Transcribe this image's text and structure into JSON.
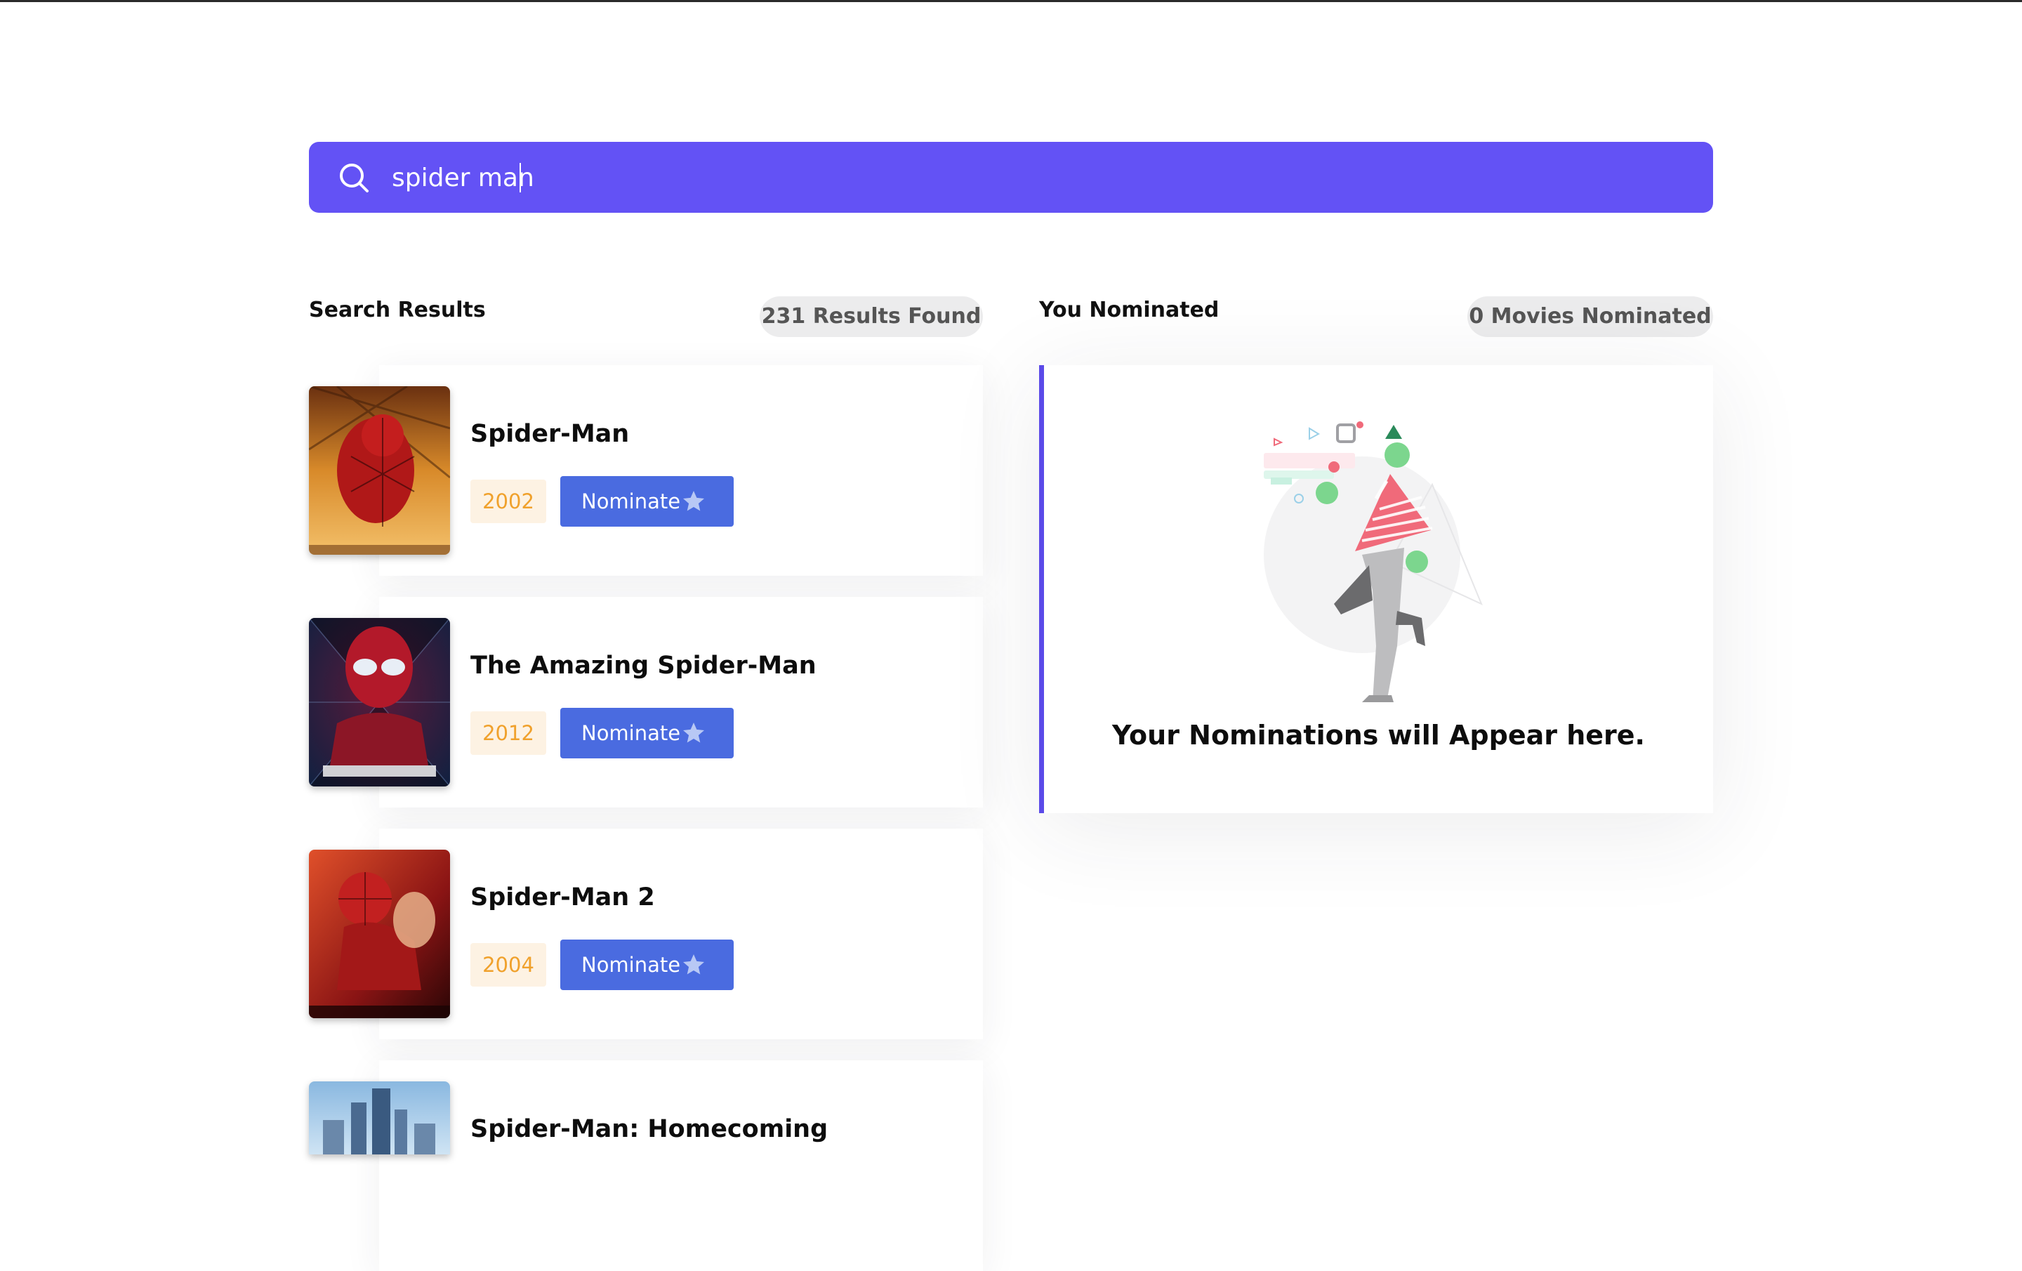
{
  "search": {
    "value": "spider man",
    "icon": "search-icon"
  },
  "results": {
    "title": "Search Results",
    "count_label": "231 Results Found",
    "nominate_label": "Nominate",
    "nominate_icon": "star-icon",
    "items": [
      {
        "title": "Spider-Man",
        "year": "2002"
      },
      {
        "title": "The Amazing Spider-Man",
        "year": "2012"
      },
      {
        "title": "Spider-Man 2",
        "year": "2004"
      },
      {
        "title": "Spider-Man: Homecoming",
        "year": ""
      }
    ]
  },
  "nominations": {
    "title": "You Nominated",
    "count_label": "0 Movies Nominated",
    "empty_text": "Your Nominations will Appear here.",
    "illustration": "empty-nominations-illustration"
  },
  "colors": {
    "search_bg": "#6352f5",
    "nominate_button": "#4a6be0",
    "year_text": "#f0a12c",
    "year_bg": "#fdf2e3",
    "panel_accent": "#5b4ae8",
    "pill_bg": "#ececed"
  }
}
